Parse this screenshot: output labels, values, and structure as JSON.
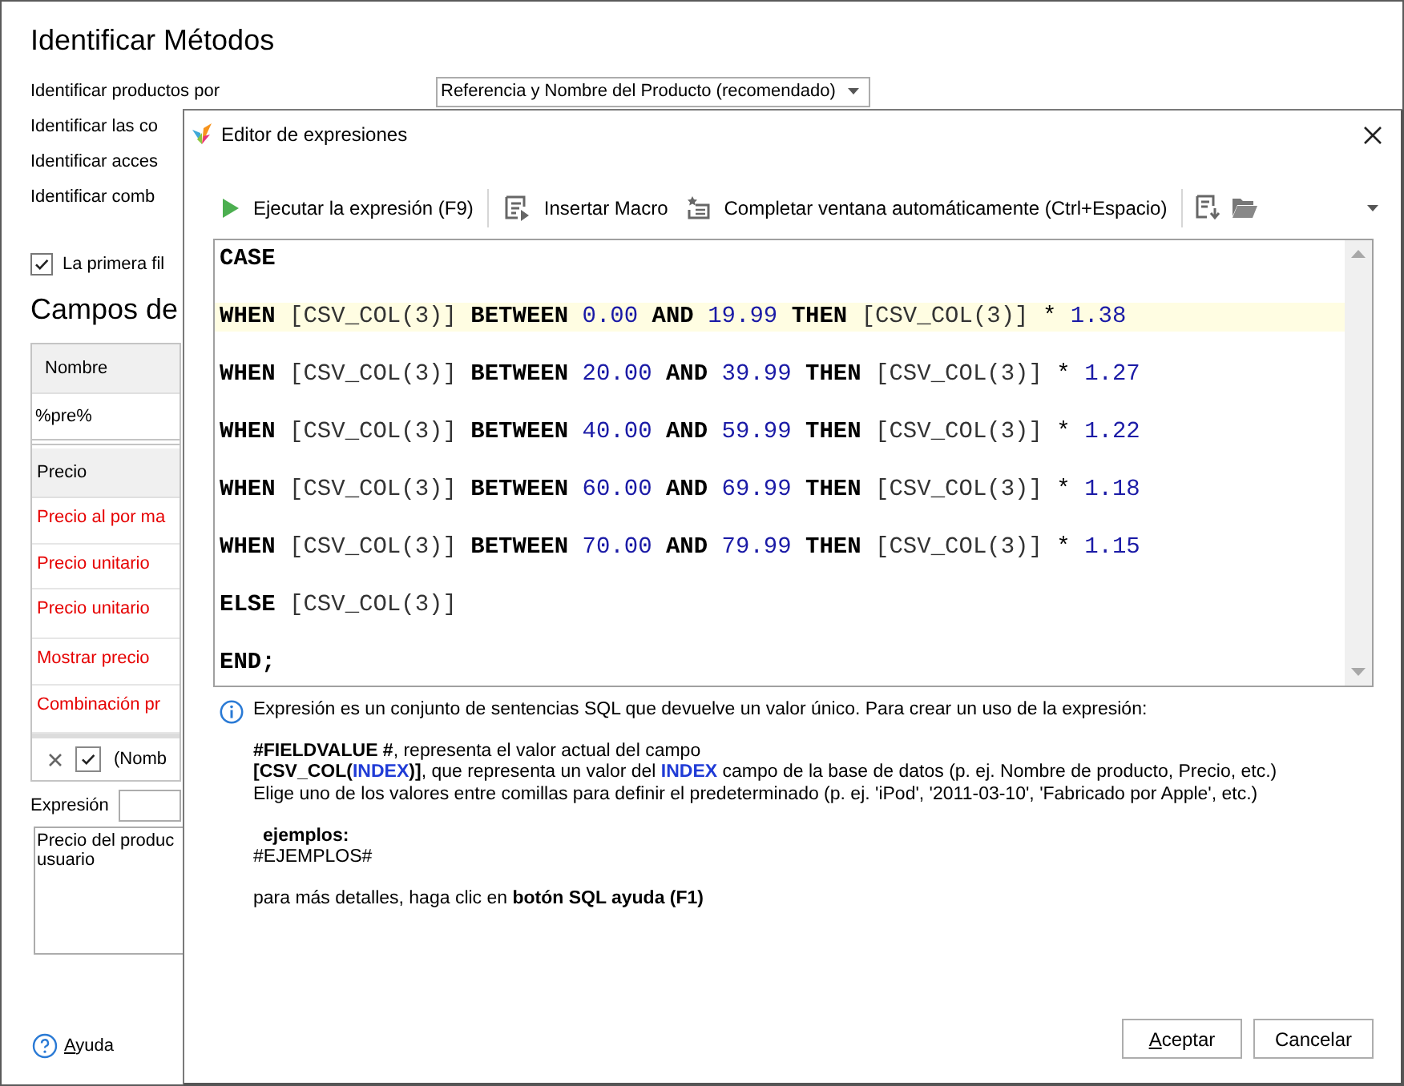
{
  "main_window": {
    "title": "Identificar Métodos",
    "settings": [
      {
        "label": "Identificar productos por",
        "value": "Referencia y Nombre del Producto (recomendado)"
      },
      {
        "label": "Identificar las co"
      },
      {
        "label": "Identificar acces"
      },
      {
        "label": "Identificar comb"
      }
    ],
    "header_checkbox": {
      "label": "La primera fil",
      "checked": true
    },
    "fields_title": "Campos de",
    "fields_table": {
      "column_1": "Nombre",
      "filter_value": "%pre%",
      "group": "Precio",
      "rows": [
        {
          "label": "Precio al por ma",
          "required": true
        },
        {
          "label": "Precio unitario",
          "required": true
        },
        {
          "label": "Precio unitario",
          "required": true
        },
        {
          "label": "Mostrar precio",
          "required": true
        },
        {
          "label": "Combinación pr",
          "required": true
        }
      ],
      "filter_bar": {
        "checked": true,
        "text": "(Nomb"
      }
    },
    "expression": {
      "label": "Expresión",
      "description": [
        "Precio del produc",
        "usuario"
      ]
    },
    "help": {
      "label": "Ayuda",
      "mnemonic": true
    }
  },
  "dialog": {
    "title": "Editor de expresiones",
    "toolbar": [
      {
        "kind": "run",
        "label": "Ejecutar la expresión (F9)"
      },
      {
        "kind": "separator"
      },
      {
        "kind": "macro",
        "label": "Insertar Macro"
      },
      {
        "kind": "autocomplete",
        "label": "Completar ventana automáticamente (Ctrl+Espacio)"
      },
      {
        "kind": "separator"
      },
      {
        "kind": "save"
      },
      {
        "kind": "open"
      },
      {
        "kind": "more"
      }
    ],
    "code_lines": [
      {
        "highlighted": false,
        "tokens": [
          {
            "kind": "keyword",
            "text": "CASE"
          }
        ]
      },
      {
        "highlighted": true,
        "tokens": [
          {
            "kind": "keyword",
            "text": "WHEN"
          },
          {
            "kind": "field",
            "text": "[CSV_COL(3)]"
          },
          {
            "kind": "keyword",
            "text": "BETWEEN"
          },
          {
            "kind": "number",
            "text": "0.00"
          },
          {
            "kind": "keyword",
            "text": "AND"
          },
          {
            "kind": "number",
            "text": "19.99"
          },
          {
            "kind": "keyword",
            "text": "THEN"
          },
          {
            "kind": "field",
            "text": "[CSV_COL(3)]"
          },
          {
            "kind": "operator",
            "text": "*"
          },
          {
            "kind": "number",
            "text": "1.38"
          }
        ]
      },
      {
        "highlighted": false,
        "tokens": [
          {
            "kind": "keyword",
            "text": "WHEN"
          },
          {
            "kind": "field",
            "text": "[CSV_COL(3)]"
          },
          {
            "kind": "keyword",
            "text": "BETWEEN"
          },
          {
            "kind": "number",
            "text": "20.00"
          },
          {
            "kind": "keyword",
            "text": "AND"
          },
          {
            "kind": "number",
            "text": "39.99"
          },
          {
            "kind": "keyword",
            "text": "THEN"
          },
          {
            "kind": "field",
            "text": "[CSV_COL(3)]"
          },
          {
            "kind": "operator",
            "text": "*"
          },
          {
            "kind": "number",
            "text": "1.27"
          }
        ]
      },
      {
        "highlighted": false,
        "tokens": [
          {
            "kind": "keyword",
            "text": "WHEN"
          },
          {
            "kind": "field",
            "text": "[CSV_COL(3)]"
          },
          {
            "kind": "keyword",
            "text": "BETWEEN"
          },
          {
            "kind": "number",
            "text": "40.00"
          },
          {
            "kind": "keyword",
            "text": "AND"
          },
          {
            "kind": "number",
            "text": "59.99"
          },
          {
            "kind": "keyword",
            "text": "THEN"
          },
          {
            "kind": "field",
            "text": "[CSV_COL(3)]"
          },
          {
            "kind": "operator",
            "text": "*"
          },
          {
            "kind": "number",
            "text": "1.22"
          }
        ]
      },
      {
        "highlighted": false,
        "tokens": [
          {
            "kind": "keyword",
            "text": "WHEN"
          },
          {
            "kind": "field",
            "text": "[CSV_COL(3)]"
          },
          {
            "kind": "keyword",
            "text": "BETWEEN"
          },
          {
            "kind": "number",
            "text": "60.00"
          },
          {
            "kind": "keyword",
            "text": "AND"
          },
          {
            "kind": "number",
            "text": "69.99"
          },
          {
            "kind": "keyword",
            "text": "THEN"
          },
          {
            "kind": "field",
            "text": "[CSV_COL(3)]"
          },
          {
            "kind": "operator",
            "text": "*"
          },
          {
            "kind": "number",
            "text": "1.18"
          }
        ]
      },
      {
        "highlighted": false,
        "tokens": [
          {
            "kind": "keyword",
            "text": "WHEN"
          },
          {
            "kind": "field",
            "text": "[CSV_COL(3)]"
          },
          {
            "kind": "keyword",
            "text": "BETWEEN"
          },
          {
            "kind": "number",
            "text": "70.00"
          },
          {
            "kind": "keyword",
            "text": "AND"
          },
          {
            "kind": "number",
            "text": "79.99"
          },
          {
            "kind": "keyword",
            "text": "THEN"
          },
          {
            "kind": "field",
            "text": "[CSV_COL(3)]"
          },
          {
            "kind": "operator",
            "text": "*"
          },
          {
            "kind": "number",
            "text": "1.15"
          }
        ]
      },
      {
        "highlighted": false,
        "tokens": [
          {
            "kind": "keyword",
            "text": "ELSE"
          },
          {
            "kind": "field",
            "text": "[CSV_COL(3)]"
          }
        ]
      },
      {
        "highlighted": false,
        "tokens": [
          {
            "kind": "keyword",
            "text": "END;"
          }
        ]
      }
    ],
    "info": {
      "intro": "Expresión es un conjunto de sentencias SQL que devuelve un valor único. Para crear un uso de la expresión:",
      "blocks": [
        [
          [
            {
              "kind": "bold",
              "text": "#FIELDVALUE #"
            },
            {
              "kind": "plain",
              "text": ", representa el valor actual del campo"
            }
          ],
          [
            {
              "kind": "bold",
              "text": "[CSV_COL("
            },
            {
              "kind": "keyword",
              "text": "INDEX"
            },
            {
              "kind": "bold",
              "text": ")]"
            },
            {
              "kind": "plain",
              "text": ", que representa un valor del "
            },
            {
              "kind": "keyword",
              "text": "INDEX"
            },
            {
              "kind": "plain",
              "text": " campo de la base de datos (p. ej. Nombre de producto, Precio, etc.)"
            }
          ],
          [
            {
              "kind": "plain",
              "text": "Elige uno de los valores entre comillas para definir el predeterminado (p. ej. 'iPod', '2011-03-10', 'Fabricado por Apple', etc.)"
            }
          ]
        ],
        [
          [
            {
              "kind": "heading",
              "text": "ejemplos:"
            }
          ],
          [
            {
              "kind": "plain",
              "text": "#EJEMPLOS#"
            }
          ]
        ],
        [
          [
            {
              "kind": "plain",
              "text": "para más detalles, haga clic en "
            },
            {
              "kind": "bold",
              "text": "botón SQL ayuda (F1)"
            }
          ]
        ]
      ]
    },
    "buttons": [
      {
        "label": "Aceptar",
        "mnemonic": true
      },
      {
        "label": "Cancelar",
        "mnemonic": false
      }
    ]
  }
}
